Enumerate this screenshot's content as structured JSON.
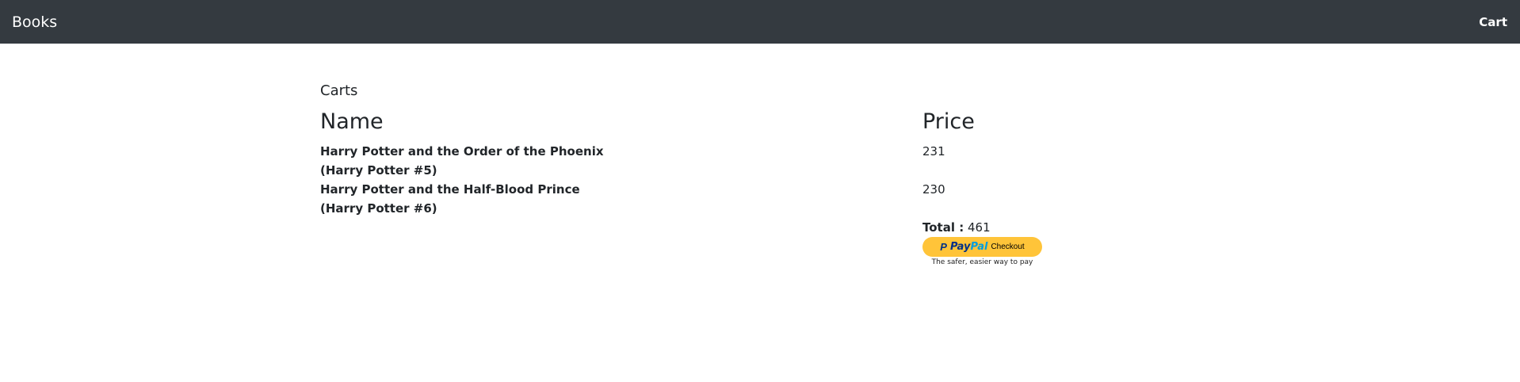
{
  "navbar": {
    "brand": "Books",
    "cart_link": "Cart"
  },
  "page": {
    "title": "Carts"
  },
  "table": {
    "columns": [
      "Name",
      "Price"
    ],
    "rows": [
      {
        "name": "Harry Potter and the Order of the Phoenix (Harry Potter #5)",
        "price": "231"
      },
      {
        "name": "Harry Potter and the Half-Blood Prince (Harry Potter #6)",
        "price": "230"
      }
    ]
  },
  "summary": {
    "total_label": "Total :",
    "total_value": "461"
  },
  "paypal": {
    "logo_pay": "Pay",
    "logo_pal": "Pal",
    "logo_p": "P",
    "checkout_label": "Checkout",
    "tagline": "The safer, easier way to pay",
    "button_color": "#ffc439"
  },
  "colors": {
    "navbar_bg": "#343a40",
    "text": "#212529"
  }
}
